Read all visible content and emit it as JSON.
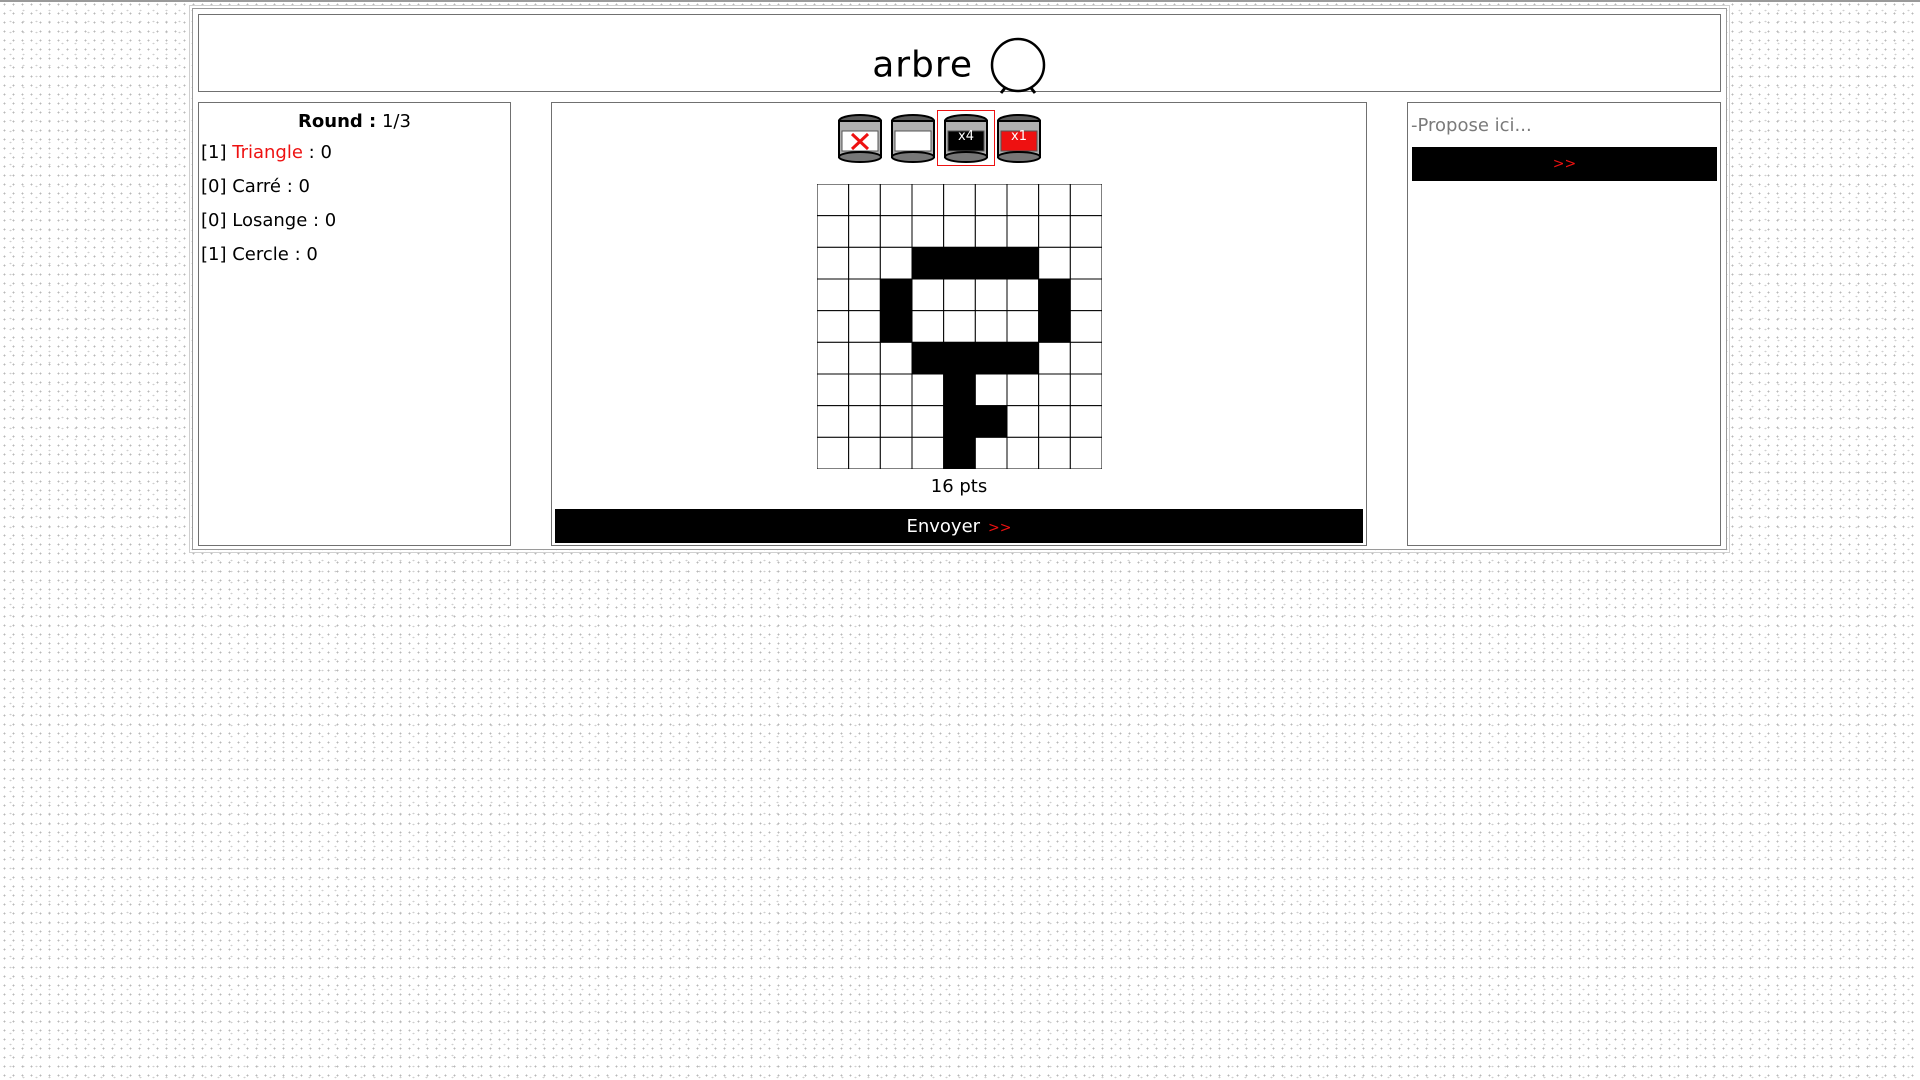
{
  "header": {
    "word": "arbre",
    "timer_icon": "stopwatch-icon"
  },
  "scores": {
    "round_label": "Round :",
    "round_value": "1/3",
    "players": [
      {
        "index": "[1]",
        "name": "Triangle",
        "score": ": 0",
        "highlight": true
      },
      {
        "index": "[0]",
        "name": "Carré",
        "score": ": 0",
        "highlight": false
      },
      {
        "index": "[0]",
        "name": "Losange",
        "score": ": 0",
        "highlight": false
      },
      {
        "index": "[1]",
        "name": "Cercle",
        "score": ": 0",
        "highlight": false
      }
    ]
  },
  "tools": [
    {
      "name": "eraser-bucket-icon",
      "label": "",
      "selected": false
    },
    {
      "name": "white-paint-bucket-icon",
      "label": "",
      "selected": false
    },
    {
      "name": "black-paint-bucket-icon",
      "label": "x4",
      "selected": true
    },
    {
      "name": "red-paint-bucket-icon",
      "label": "x1",
      "selected": false
    }
  ],
  "canvas": {
    "columns": 9,
    "rows": 9,
    "filled": [
      "000000000",
      "000000000",
      "000111100",
      "001000010",
      "001000010",
      "000111100",
      "000010000",
      "000011000",
      "000010000"
    ]
  },
  "points": "16 pts",
  "send": {
    "label": "Envoyer",
    "arrows": ">>"
  },
  "guess": {
    "placeholder": "-Propose ici...",
    "button_label": ">>"
  },
  "colors": {
    "accent_red": "#ee1111",
    "ink": "#000000"
  }
}
